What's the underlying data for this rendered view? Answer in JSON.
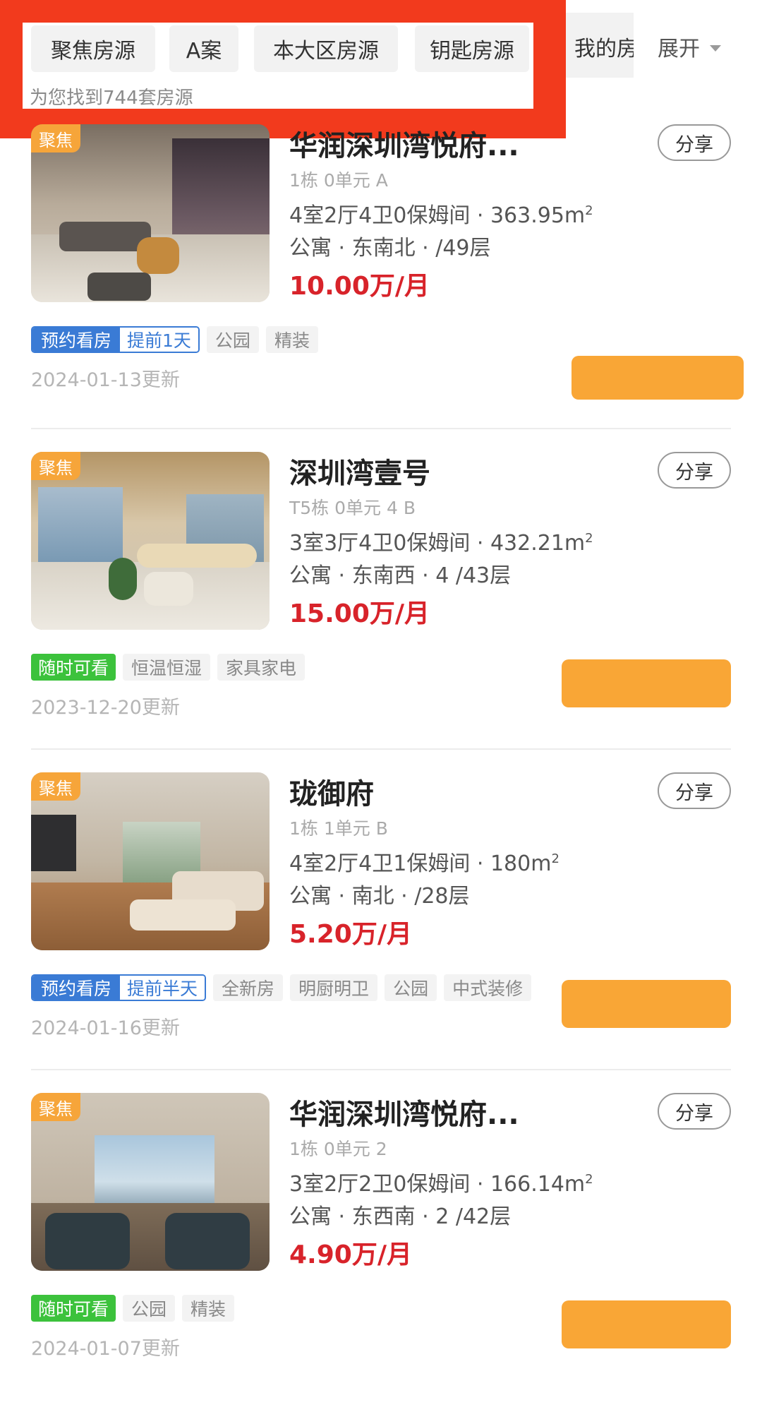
{
  "filter_bar": {
    "tabs": [
      "聚焦房源",
      "A案",
      "本大区房源",
      "钥匙房源"
    ],
    "partial_tab": "我的房",
    "expand_label": "展开",
    "result_count_text": "为您找到744套房源"
  },
  "listings": [
    {
      "focus_label": "聚焦",
      "title": "华润深圳湾悦府...",
      "unit": "1栋 0单元 A",
      "specs": "4室2厅4卫0保姆间 · 363.95m",
      "type_line": "公寓 · 东南北 · /49层",
      "price": "10.00万/月",
      "share_label": "分享",
      "appointment": {
        "label": "预约看房",
        "advance": "提前1天"
      },
      "available_anytime": "",
      "tags": [
        "公园",
        "精装"
      ],
      "updated": "2024-01-13更新"
    },
    {
      "focus_label": "聚焦",
      "title": "深圳湾壹号",
      "unit": "T5栋 0单元 4 B",
      "specs": "3室3厅4卫0保姆间 · 432.21m",
      "type_line": "公寓 · 东南西 · 4 /43层",
      "price": "15.00万/月",
      "share_label": "分享",
      "appointment": null,
      "available_anytime": "随时可看",
      "tags": [
        "恒温恒湿",
        "家具家电"
      ],
      "updated": "2023-12-20更新"
    },
    {
      "focus_label": "聚焦",
      "title": "珑御府",
      "unit": "1栋 1单元 B",
      "specs": "4室2厅4卫1保姆间 · 180m",
      "type_line": "公寓 · 南北 · /28层",
      "price": "5.20万/月",
      "share_label": "分享",
      "appointment": {
        "label": "预约看房",
        "advance": "提前半天"
      },
      "available_anytime": "",
      "tags": [
        "全新房",
        "明厨明卫",
        "公园",
        "中式装修"
      ],
      "updated": "2024-01-16更新"
    },
    {
      "focus_label": "聚焦",
      "title": "华润深圳湾悦府...",
      "unit": "1栋 0单元 2",
      "specs": "3室2厅2卫0保姆间 · 166.14m",
      "type_line": "公寓 · 东西南 · 2 /42层",
      "price": "4.90万/月",
      "share_label": "分享",
      "appointment": null,
      "available_anytime": "随时可看",
      "tags": [
        "公园",
        "精装"
      ],
      "updated": "2024-01-07更新"
    }
  ],
  "colors": {
    "highlight_red": "#f23a1d",
    "price_red": "#d8232a",
    "focus_orange": "#f6a53a",
    "cta_orange": "#f9a636",
    "appt_blue": "#3a7bd5",
    "available_green": "#3cc23c"
  }
}
